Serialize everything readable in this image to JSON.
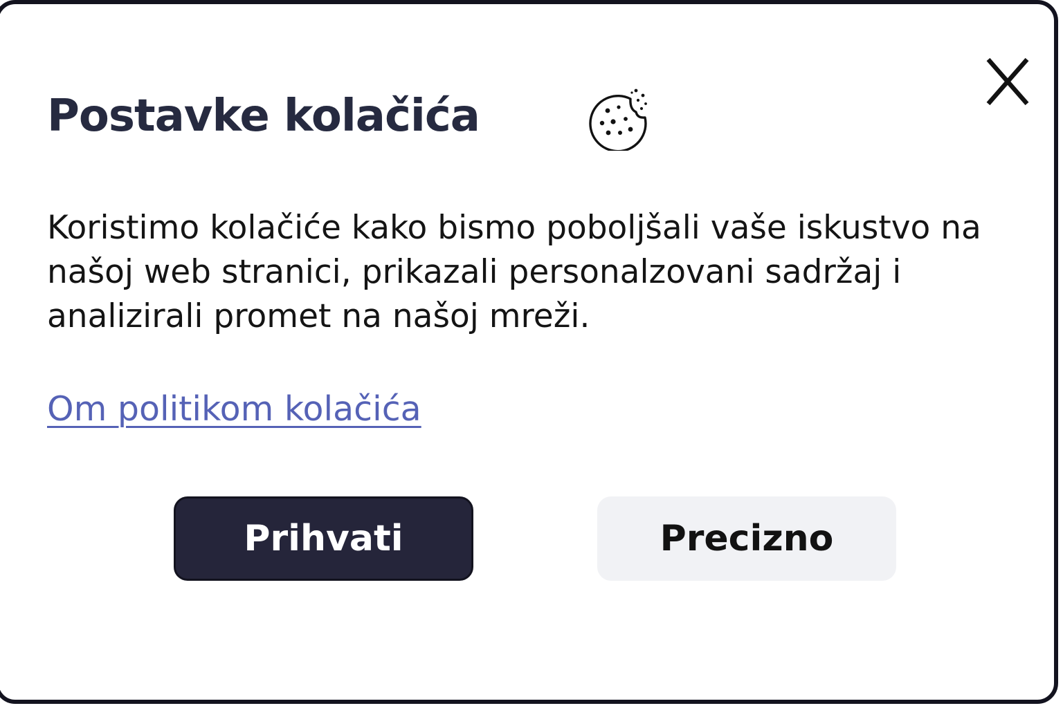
{
  "dialog": {
    "title": "Postavke kolačića",
    "description": "Koristimo kolačiće kako bismo poboljšali vaše iskustvo na našoj web stranici, prikazali personalzovani sadržaj i analizirali promet na našoj mreži.",
    "policy_link": "Om politikom kolačića",
    "close_label": "X",
    "icons": {
      "title_icon": "cookie-icon",
      "close_icon": "close-icon"
    },
    "buttons": {
      "accept": "Prihvati",
      "precise": "Precizno"
    },
    "colors": {
      "title": "#262a40",
      "primary_button": "#25253a",
      "secondary_button": "#f1f2f5",
      "link": "#5562b6",
      "border": "#13131f"
    }
  }
}
